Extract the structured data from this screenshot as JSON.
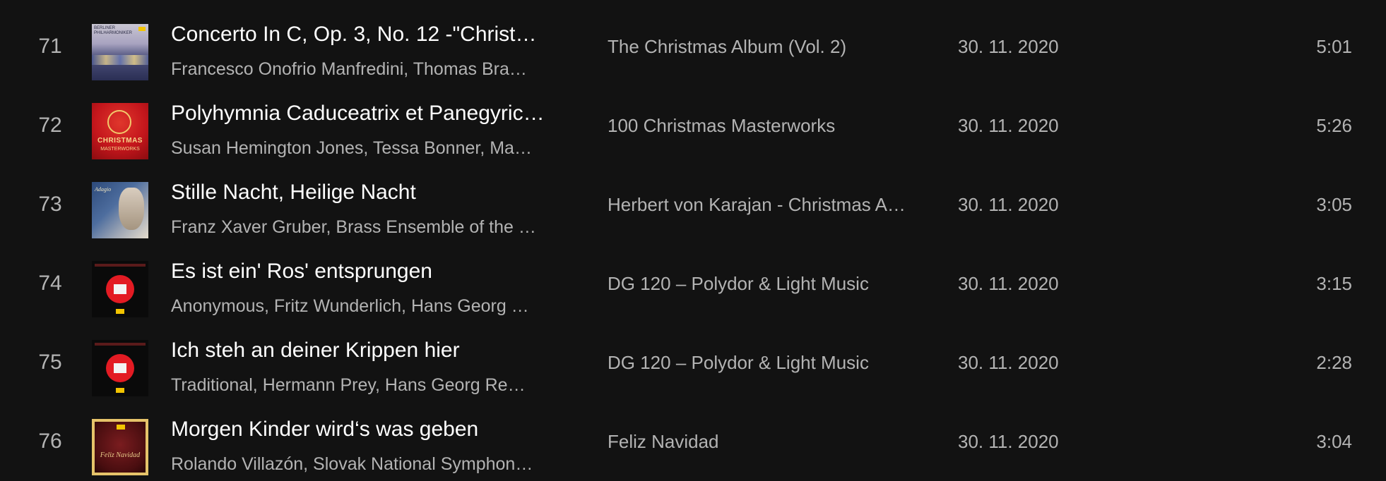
{
  "tracks": [
    {
      "number": "71",
      "title": "Concerto In C, Op. 3, No. 12 -\"Christ…",
      "artists": "Francesco Onofrio Manfredini, Thomas Bra…",
      "album": "The Christmas Album (Vol. 2)",
      "date_added": "30. 11. 2020",
      "duration": "5:01",
      "cover_icon": "album-cover-berlin-icon",
      "cover_text": "BERLINER PHILHARMONIKER"
    },
    {
      "number": "72",
      "title": "Polyhymnia Caduceatrix et Panegyric…",
      "artists": "Susan Hemington Jones, Tessa Bonner, Ma…",
      "album": "100 Christmas Masterworks",
      "date_added": "30. 11. 2020",
      "duration": "5:26",
      "cover_icon": "album-cover-100-christmas-icon",
      "cover_text": "CHRISTMAS",
      "cover_text2": "MASTERWORKS"
    },
    {
      "number": "73",
      "title": "Stille Nacht, Heilige Nacht",
      "artists": "Franz Xaver Gruber, Brass Ensemble of the …",
      "album": "Herbert von Karajan - Christmas A…",
      "date_added": "30. 11. 2020",
      "duration": "3:05",
      "cover_icon": "album-cover-karajan-icon",
      "cover_text": "Adagio"
    },
    {
      "number": "74",
      "title": "Es ist ein' Ros' entsprungen",
      "artists": "Anonymous, Fritz Wunderlich, Hans Georg …",
      "album": "DG 120 – Polydor & Light Music",
      "date_added": "30. 11. 2020",
      "duration": "3:15",
      "cover_icon": "album-cover-dg120-icon"
    },
    {
      "number": "75",
      "title": "Ich steh an deiner Krippen hier",
      "artists": "Traditional, Hermann Prey, Hans Georg Re…",
      "album": "DG 120 – Polydor & Light Music",
      "date_added": "30. 11. 2020",
      "duration": "2:28",
      "cover_icon": "album-cover-dg120-icon"
    },
    {
      "number": "76",
      "title": "Morgen Kinder wird‘s was geben",
      "artists": "Rolando Villazón, Slovak National Symphon…",
      "album": "Feliz Navidad",
      "date_added": "30. 11. 2020",
      "duration": "3:04",
      "cover_icon": "album-cover-feliz-navidad-icon",
      "cover_text": "Feliz Navidad"
    }
  ],
  "colors": {
    "background": "#121212",
    "primary_text": "#ffffff",
    "secondary_text": "#b3b3b3"
  }
}
